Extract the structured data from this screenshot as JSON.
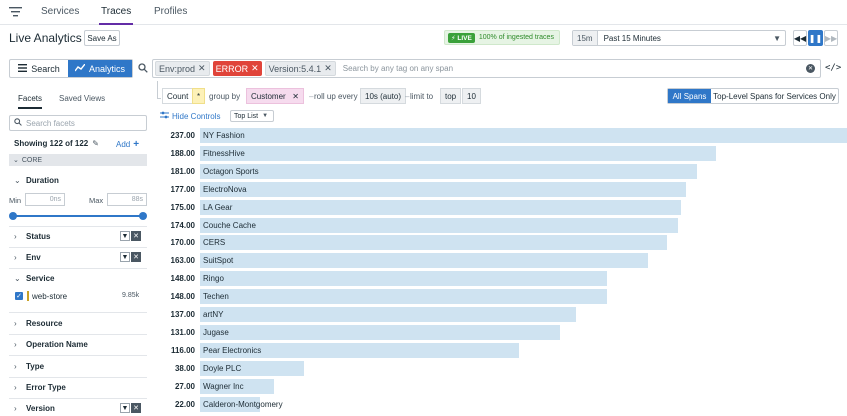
{
  "nav": {
    "tabs": [
      "Services",
      "Traces",
      "Profiles"
    ],
    "active": "Traces"
  },
  "header": {
    "title": "Live Analytics",
    "save_as": "Save As",
    "live_chip": "LIVE",
    "live_text": "100% of ingested traces",
    "time_short": "15m",
    "time_label": "Past 15 Minutes"
  },
  "search": {
    "tab_search": "Search",
    "tab_analytics": "Analytics",
    "tags": [
      "Env:prod",
      "ERROR",
      "Version:5.4.1"
    ],
    "placeholder": "Search by any tag on any span"
  },
  "query": {
    "measure": "Count",
    "measure_field": "*",
    "group_by_label": "group by",
    "group_by": "Customer",
    "rollup_label": "roll up every",
    "rollup": "10s (auto)",
    "limit_label": "limit to",
    "limit_dir": "top",
    "limit_n": "10",
    "all_spans": "All Spans",
    "top_level": "Top-Level Spans for Services Only"
  },
  "sidebar": {
    "tabs": [
      "Facets",
      "Saved Views"
    ],
    "search_placeholder": "Search facets",
    "showing": "Showing 122 of 122",
    "add": "Add",
    "core": "CORE",
    "duration": {
      "label": "Duration",
      "min_label": "Min",
      "min_value": "0ns",
      "max_label": "Max",
      "max_value": "88s"
    },
    "facets": [
      "Status",
      "Env",
      "Service",
      "Resource",
      "Operation Name",
      "Type",
      "Error Type",
      "Version"
    ],
    "service_value": {
      "label": "web-store",
      "count": "9.85k"
    }
  },
  "chart_controls": {
    "hide_controls": "Hide Controls",
    "viz": "Top List"
  },
  "chart_data": {
    "type": "bar",
    "orientation": "horizontal",
    "categories": [
      "NY Fashion",
      "FitnessHive",
      "Octagon Sports",
      "ElectroNova",
      "LA Gear",
      "Couche Cache",
      "CERS",
      "SuitSpot",
      "Ringo",
      "Techen",
      "artNY",
      "Jugase",
      "Pear Electronics",
      "Doyle PLC",
      "Wagner Inc",
      "Calderon-Montgomery"
    ],
    "values": [
      237.0,
      188.0,
      181.0,
      177.0,
      175.0,
      174.0,
      170.0,
      163.0,
      148.0,
      148.0,
      137.0,
      131.0,
      116.0,
      38.0,
      27.0,
      22.0
    ],
    "value_labels": [
      "237.00",
      "188.00",
      "181.00",
      "177.00",
      "175.00",
      "174.00",
      "170.00",
      "163.00",
      "148.00",
      "148.00",
      "137.00",
      "131.00",
      "116.00",
      "38.00",
      "27.00",
      "22.00"
    ],
    "bar_color": "#cfe3f1"
  },
  "colors": {
    "accent": "#2f77c8",
    "error": "#e0443a",
    "live": "#3aa13a",
    "nav_underline": "#632ca6"
  }
}
